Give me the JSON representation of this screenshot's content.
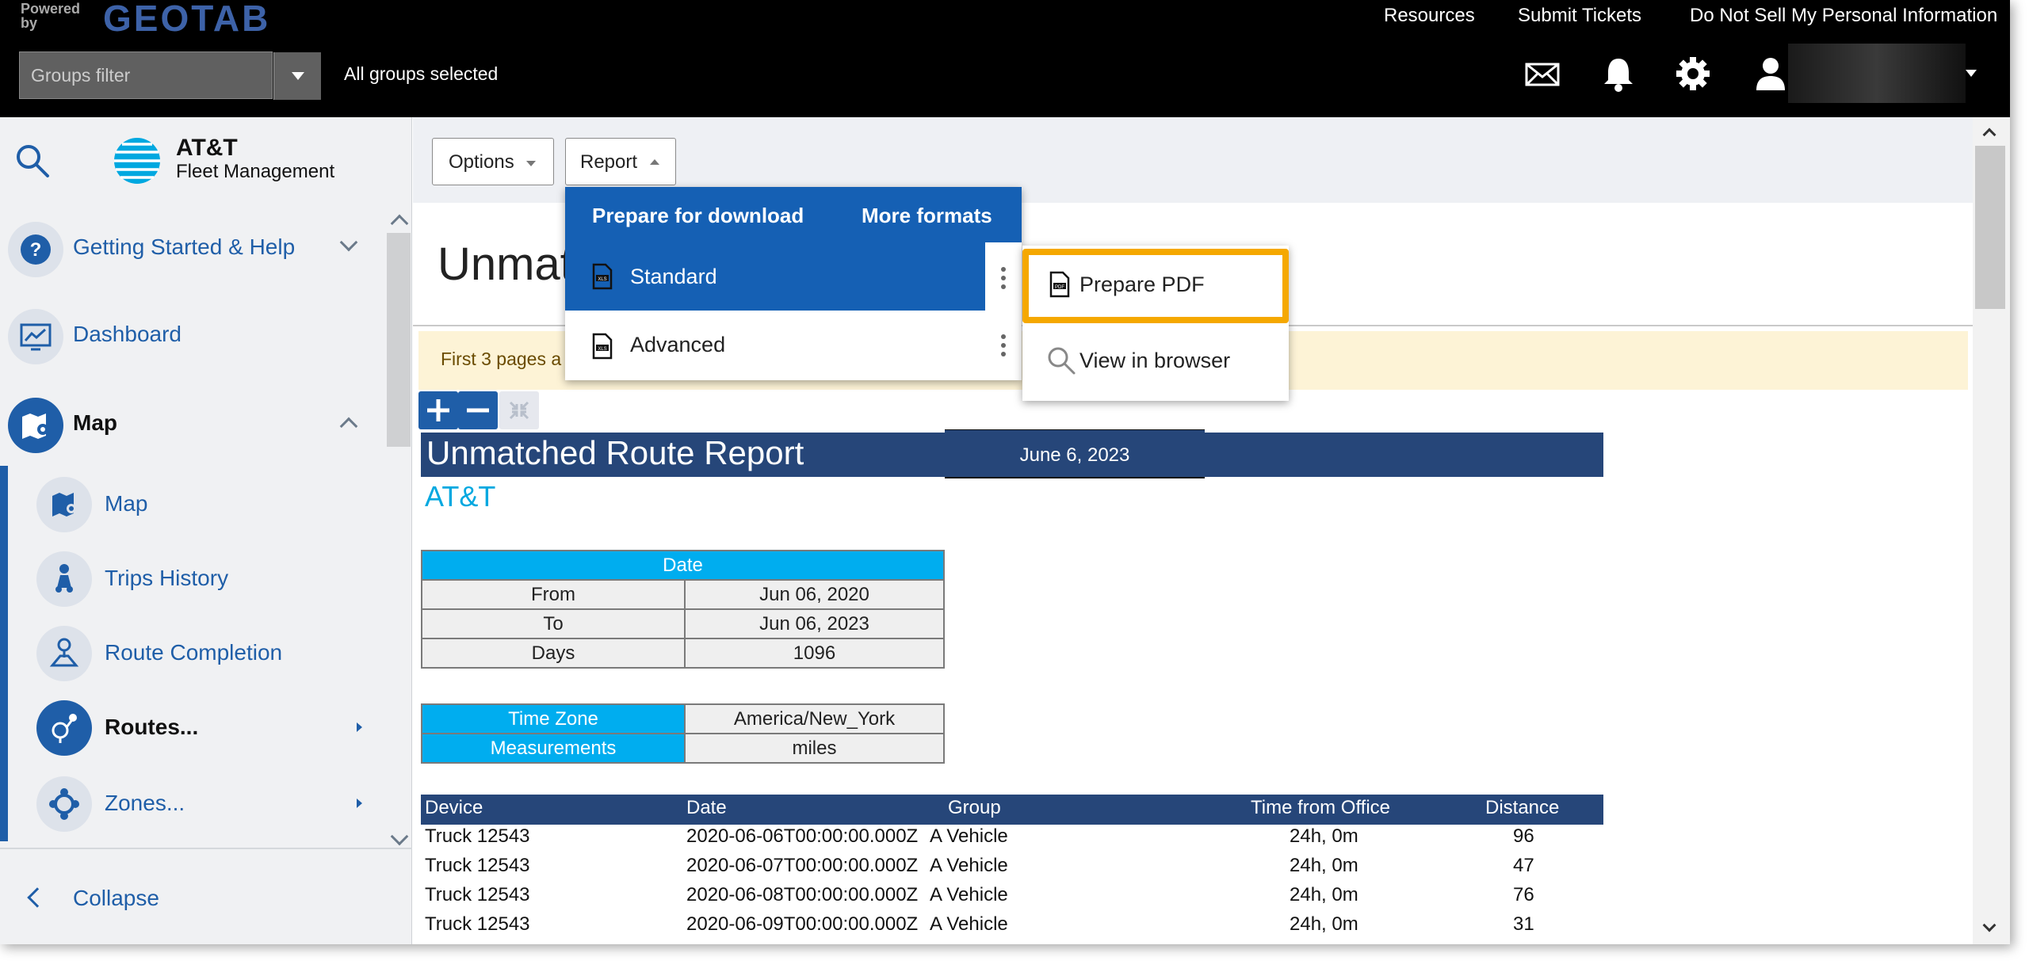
{
  "topbar": {
    "powered_by": "Powered by",
    "logo": "GEOTAB",
    "links": [
      "Resources",
      "Submit Tickets",
      "Do Not Sell My Personal Information"
    ],
    "groups_filter_placeholder": "Groups filter",
    "groups_status": "All groups selected",
    "icons": [
      "mail-icon",
      "bell-icon",
      "gear-icon",
      "user-icon"
    ]
  },
  "sidebar": {
    "brand_name": "AT&T",
    "brand_sub": "Fleet Management",
    "items": [
      {
        "label": "Getting Started & Help",
        "icon": "help-icon"
      },
      {
        "label": "Dashboard",
        "icon": "dashboard-icon"
      },
      {
        "label": "Map",
        "icon": "map-icon"
      }
    ],
    "sub_items": [
      {
        "label": "Map",
        "icon": "map-icon"
      },
      {
        "label": "Trips History",
        "icon": "trips-icon"
      },
      {
        "label": "Route Completion",
        "icon": "route-completion-icon"
      },
      {
        "label": "Routes...",
        "icon": "routes-icon"
      },
      {
        "label": "Zones...",
        "icon": "zones-icon"
      }
    ],
    "collapse_label": "Collapse"
  },
  "toolbar": {
    "options_label": "Options",
    "report_label": "Report"
  },
  "page": {
    "title": "Unmat",
    "notice": "First 3 pages a"
  },
  "menu": {
    "header_left": "Prepare for download",
    "header_right": "More formats",
    "items": [
      {
        "label": "Standard",
        "icon": "xls-file-icon"
      },
      {
        "label": "Advanced",
        "icon": "xls-file-icon"
      }
    ],
    "submenu": [
      {
        "label": "Prepare PDF",
        "icon": "pdf-file-icon"
      },
      {
        "label": "View in browser",
        "icon": "search-icon"
      }
    ]
  },
  "report": {
    "title": "Unmatched Route Report",
    "date": "June 6, 2023",
    "company": "AT&T",
    "date_table": {
      "header": "Date",
      "rows": [
        [
          "From",
          "Jun 06, 2020"
        ],
        [
          "To",
          "Jun 06, 2023"
        ],
        [
          "Days",
          "1096"
        ]
      ]
    },
    "settings_table": {
      "rows": [
        [
          "Time Zone",
          "America/New_York"
        ],
        [
          "Measurements",
          "miles"
        ]
      ]
    },
    "columns": [
      "Device",
      "Date",
      "Group",
      "Time from Office",
      "Distance"
    ],
    "rows": [
      [
        "Truck 12543",
        "2020-06-06T00:00:00.000Z",
        "A Vehicle",
        "24h, 0m",
        "96"
      ],
      [
        "Truck 12543",
        "2020-06-07T00:00:00.000Z",
        "A Vehicle",
        "24h, 0m",
        "47"
      ],
      [
        "Truck 12543",
        "2020-06-08T00:00:00.000Z",
        "A Vehicle",
        "24h, 0m",
        "76"
      ],
      [
        "Truck 12543",
        "2020-06-09T00:00:00.000Z",
        "A Vehicle",
        "24h, 0m",
        "31"
      ]
    ]
  },
  "colors": {
    "topbar": "#000000",
    "brand_blue": "#1f5ea8",
    "menu_blue": "#1560b4",
    "report_header": "#264679",
    "table_cyan": "#00adef",
    "highlight": "#f5a800"
  }
}
